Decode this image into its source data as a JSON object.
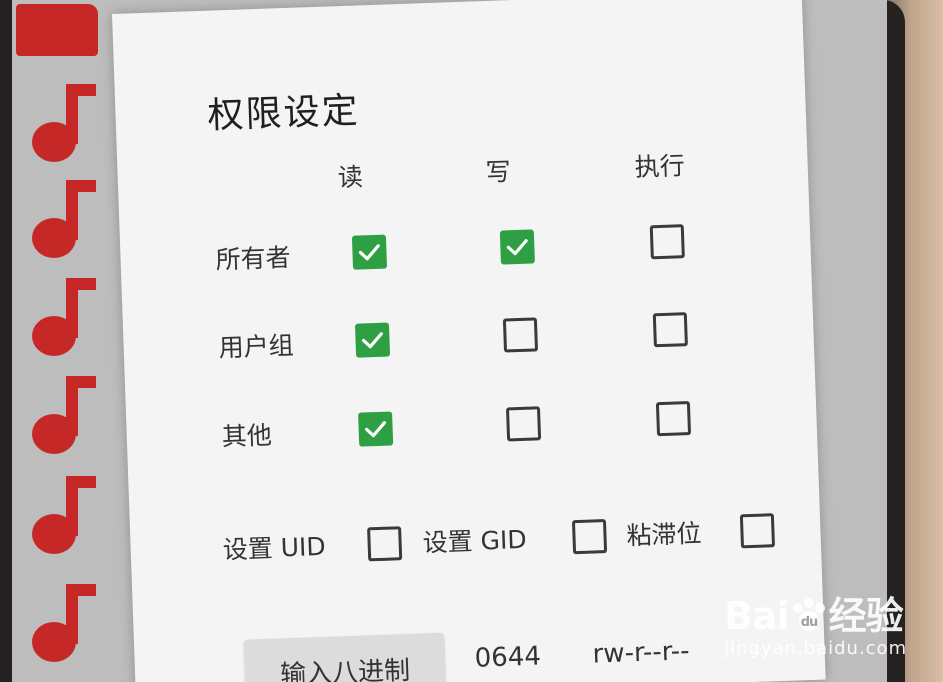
{
  "dialog": {
    "title": "权限设定",
    "columns": [
      "读",
      "写",
      "执行"
    ],
    "rows": [
      {
        "label": "所有者",
        "read": true,
        "write": true,
        "execute": false
      },
      {
        "label": "用户组",
        "read": true,
        "write": false,
        "execute": false
      },
      {
        "label": "其他",
        "read": true,
        "write": false,
        "execute": false
      }
    ],
    "options": {
      "set_uid_label": "设置 UID",
      "set_uid": false,
      "set_gid_label": "设置 GID",
      "set_gid": false,
      "sticky_label": "粘滞位",
      "sticky": false
    },
    "footer": {
      "input_octal_button": "输入八进制",
      "octal_value": "0644",
      "permission_string": "rw-r--r--"
    }
  },
  "sidebar": {
    "icons": [
      "folder-icon",
      "music-note-icon",
      "music-note-icon",
      "music-note-icon",
      "music-note-icon",
      "music-note-icon",
      "music-note-icon"
    ]
  },
  "watermark": {
    "logo": "Bai du 经验",
    "url": "jingyan.baidu.com"
  },
  "colors": {
    "checked": "#2ea043",
    "icon_red": "#c62828",
    "dialog_bg": "#f4f4f4"
  }
}
